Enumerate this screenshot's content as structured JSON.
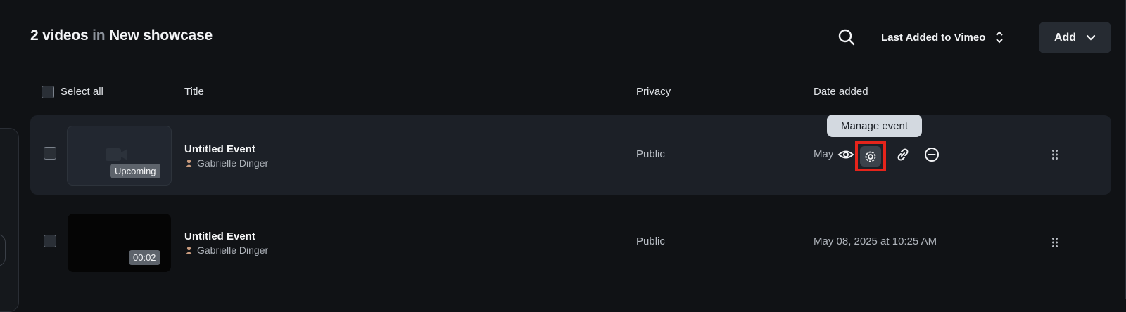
{
  "header": {
    "count_label": "2 videos",
    "in_label": "in",
    "showcase_name": "New showcase",
    "sort_label": "Last Added to Vimeo",
    "add_label": "Add"
  },
  "columns": {
    "select_all": "Select all",
    "title": "Title",
    "privacy": "Privacy",
    "date_added": "Date added"
  },
  "rows": [
    {
      "title": "Untitled Event",
      "owner": "Gabrielle Dinger",
      "badge": "Upcoming",
      "privacy": "Public",
      "date": "May"
    },
    {
      "title": "Untitled Event",
      "owner": "Gabrielle Dinger",
      "badge": "00:02",
      "privacy": "Public",
      "date": "May 08, 2025 at 10:25 AM"
    }
  ],
  "tooltip": "Manage event",
  "icons": [
    "search-icon",
    "sort-icon",
    "chevron-down-icon",
    "camera-icon",
    "user-icon",
    "eye-icon",
    "gear-icon",
    "link-icon",
    "remove-icon",
    "drag-handle-icon"
  ],
  "colors": {
    "highlight": "#e5241b",
    "background": "#101215",
    "row_hover": "#1c2027"
  }
}
